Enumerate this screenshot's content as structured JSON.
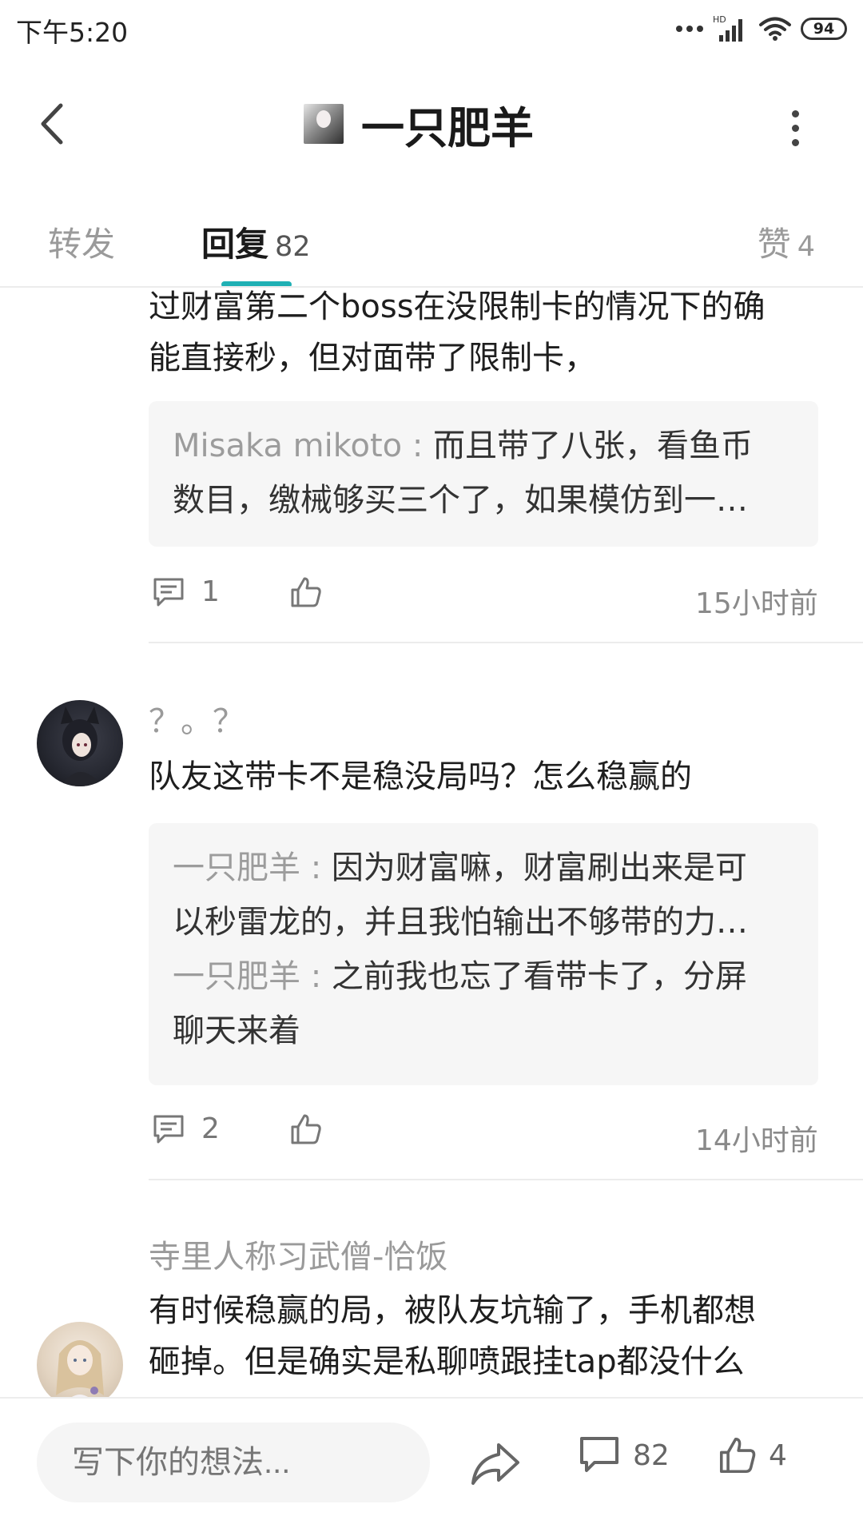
{
  "status_bar": {
    "time": "下午5:20",
    "hd": "HD",
    "battery": "94"
  },
  "header": {
    "title": "一只肥羊"
  },
  "tabs": {
    "forward": "转发",
    "reply": "回复",
    "reply_count": "82",
    "like": "赞",
    "like_count": "4"
  },
  "comments": [
    {
      "text_lines": [
        "过财富第二个boss在没限制卡的情况下的确",
        "能直接秒，但对面带了限制卡，"
      ],
      "quote": [
        {
          "name": "Misaka mikoto",
          "sep": " : ",
          "line1": "而且带了八张，看鱼币",
          "line2": "数目，缴械够买三个了，如果模仿到一…"
        }
      ],
      "reply_count": "1",
      "time": "15小时前"
    },
    {
      "user": "？。？",
      "text": "队友这带卡不是稳没局吗？怎么稳赢的",
      "quote": [
        {
          "name": "一只肥羊",
          "sep": " : ",
          "line1": "因为财富嘛，财富刷出来是可",
          "line2": "以秒雷龙的，并且我怕输出不够带的力…"
        },
        {
          "name": "一只肥羊",
          "sep": " : ",
          "line1": "之前我也忘了看带卡了，分屏",
          "line2": "聊天来着"
        }
      ],
      "reply_count": "2",
      "time": "14小时前"
    },
    {
      "user": "寺里人称习武僧-恰饭",
      "text_lines": [
        "有时候稳赢的局，被队友坑输了，手机都想",
        "砸掉。但是确实是私聊喷跟挂tap都没什么"
      ]
    }
  ],
  "bottom_bar": {
    "placeholder": "写下你的想法...",
    "comment_count": "82",
    "like_count": "4"
  }
}
